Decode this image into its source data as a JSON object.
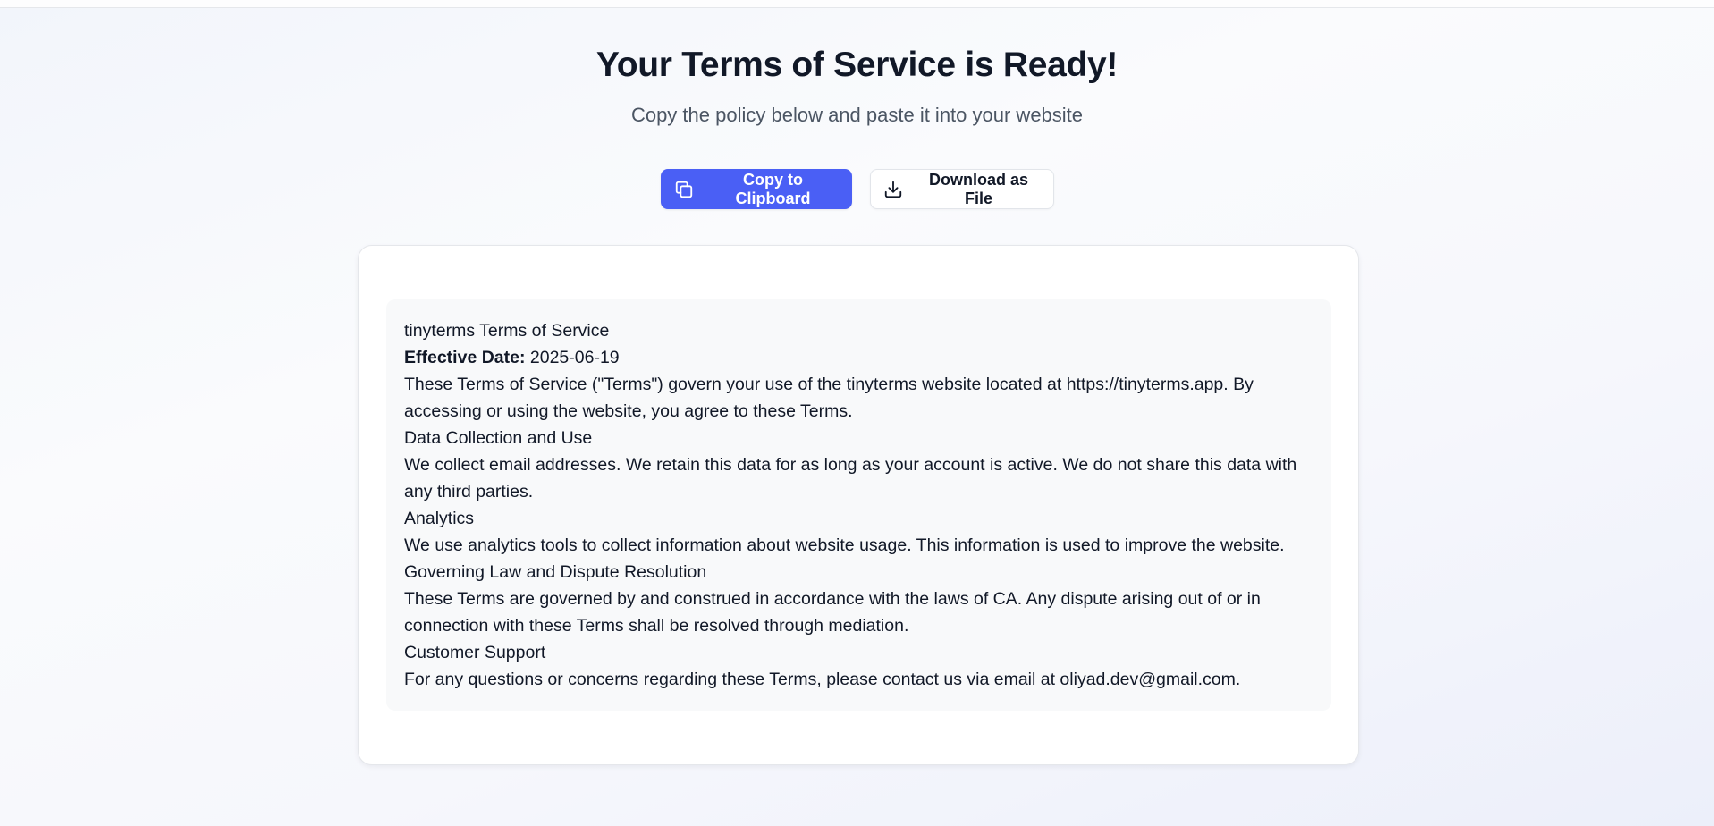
{
  "header": {
    "title": "Your Terms of Service is Ready!",
    "subtitle": "Copy the policy below and paste it into your website"
  },
  "actions": {
    "copy": {
      "label": "Copy to Clipboard",
      "icon": "copy-icon"
    },
    "download": {
      "label": "Download as File",
      "icon": "download-icon"
    }
  },
  "policy": {
    "title": "tinyterms Terms of Service",
    "effective_date_label": "Effective Date:",
    "effective_date_value": "2025-06-19",
    "intro": "These Terms of Service (\"Terms\") govern your use of the tinyterms website located at https://tinyterms.app. By accessing or using the website, you agree to these Terms.",
    "sections": [
      {
        "heading": "Data Collection and Use",
        "body": "We collect email addresses. We retain this data for as long as your account is active. We do not share this data with any third parties."
      },
      {
        "heading": "Analytics",
        "body": "We use analytics tools to collect information about website usage. This information is used to improve the website."
      },
      {
        "heading": "Governing Law and Dispute Resolution",
        "body": "These Terms are governed by and construed in accordance with the laws of CA. Any dispute arising out of or in connection with these Terms shall be resolved through mediation."
      },
      {
        "heading": "Customer Support",
        "body": "For any questions or concerns regarding these Terms, please contact us via email at oliyad.dev@gmail.com."
      }
    ]
  },
  "colors": {
    "primary": "#4a5ff5",
    "title_text": "#111827",
    "subtitle_text": "#4b5563",
    "policy_background": "#f8f9fa"
  }
}
